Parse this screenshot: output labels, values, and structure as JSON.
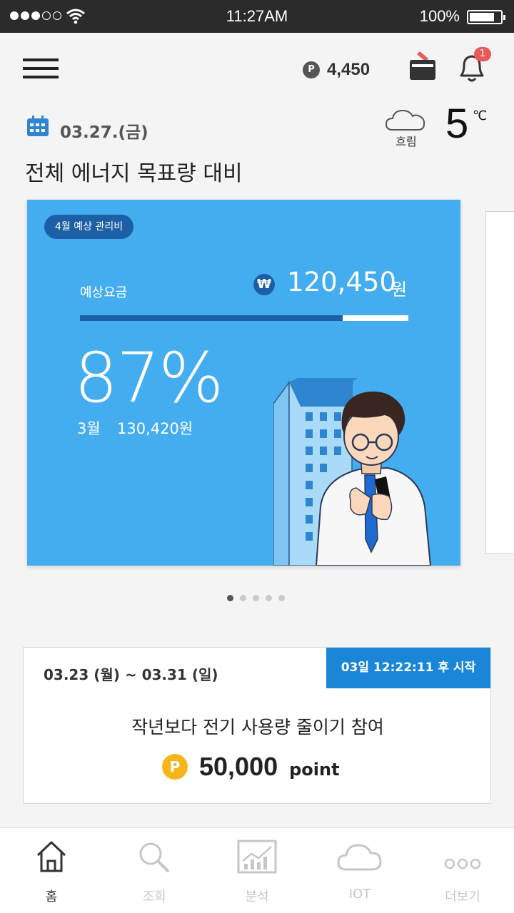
{
  "status_bar": {
    "time": "11:27AM",
    "battery": "100%"
  },
  "header": {
    "points": "4,450",
    "point_badge": "P",
    "notification_count": "1"
  },
  "date_row": {
    "date": "03.27.(금)",
    "weather": "흐림",
    "temperature": "5",
    "temperature_unit": "℃"
  },
  "section_title": "전체 에너지 목표량 대비",
  "energy_card": {
    "badge": "4월 예상 관리비",
    "estimate_label": "예상요금",
    "currency_symbol": "₩",
    "estimate_amount": "120,450",
    "estimate_unit": "원",
    "progress_fraction": 0.8,
    "percent": "87%",
    "prev_month": "3월",
    "prev_amount": "130,420원"
  },
  "pager": {
    "count": 5,
    "active": 0
  },
  "event": {
    "period": "03.23 (월) ~ 03.31 (일)",
    "countdown": "03일 12:22:11 후 시작",
    "title": "작년보다 전기 사용량 줄이기 참여",
    "point_badge": "P",
    "points": "50,000",
    "points_unit": "point"
  },
  "bottom_nav": [
    {
      "label": "홈",
      "icon": "home-icon",
      "active": true
    },
    {
      "label": "조회",
      "icon": "search-icon",
      "active": false
    },
    {
      "label": "분석",
      "icon": "chart-icon",
      "active": false
    },
    {
      "label": "IOT",
      "icon": "cloud-icon",
      "active": false
    },
    {
      "label": "더보기",
      "icon": "more-icon",
      "active": false
    }
  ],
  "colors": {
    "card_blue": "#44adf0",
    "dark_blue": "#1d5fa5",
    "tag_blue": "#1a86d8",
    "point_gold": "#f7b51c"
  }
}
